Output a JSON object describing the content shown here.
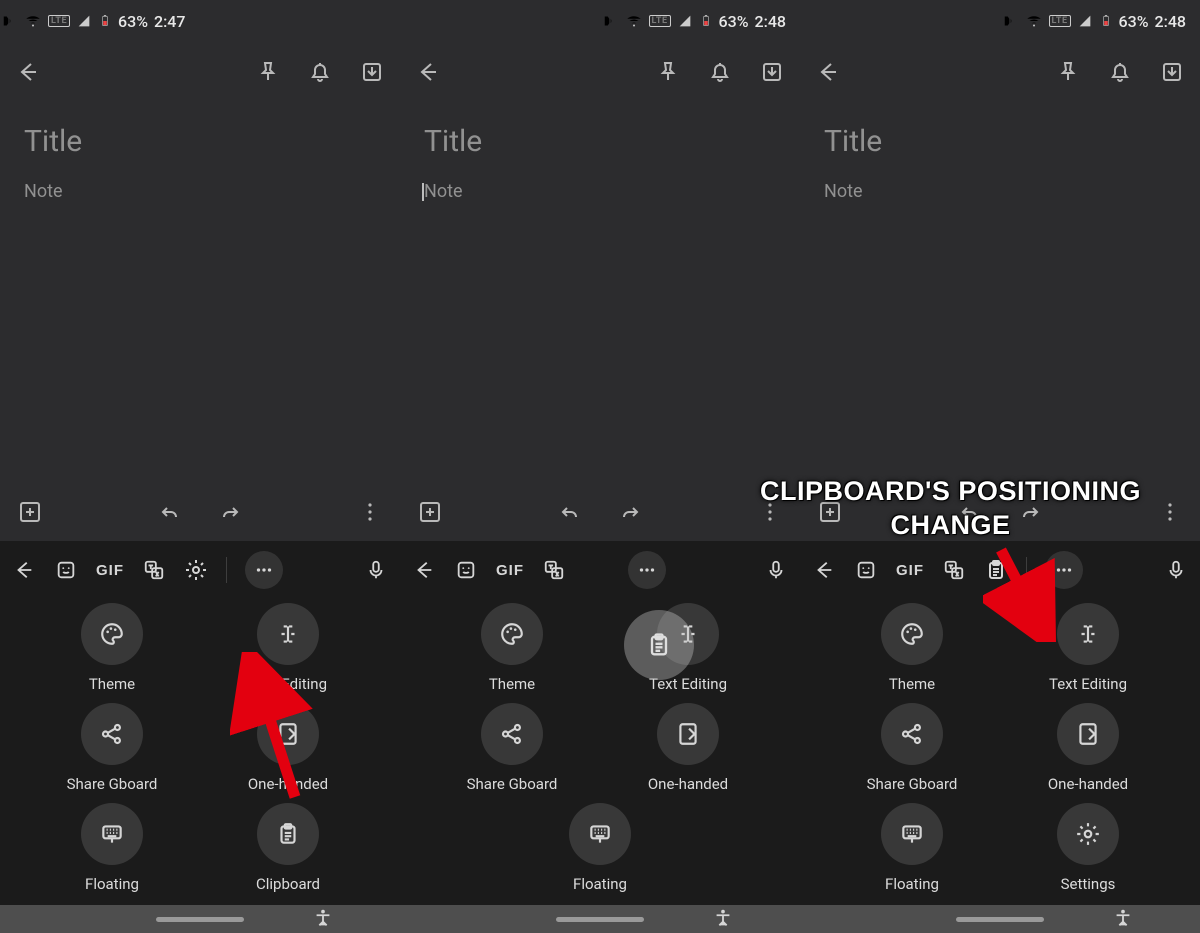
{
  "annotation": {
    "text": "CLIPBOARD'S POSITIONING\nCHANGE"
  },
  "panels": [
    {
      "status": {
        "battery_pct": "63%",
        "time": "2:47",
        "show_pic_icon": true
      },
      "content": {
        "title_placeholder": "Title",
        "note_placeholder": "Note",
        "caret": false
      },
      "kbar": {
        "slot5": "settings",
        "more_pill": true,
        "pre_sep": true
      },
      "tiles": [
        {
          "icon": "palette",
          "label": "Theme"
        },
        {
          "icon": "ibeam",
          "label": "Text Editing"
        },
        {
          "icon": "share",
          "label": "Share Gboard"
        },
        {
          "icon": "onehand",
          "label": "One-handed"
        },
        {
          "icon": "floatkb",
          "label": "Floating"
        },
        {
          "icon": "clipboard",
          "label": "Clipboard"
        }
      ]
    },
    {
      "status": {
        "battery_pct": "63%",
        "time": "2:48",
        "show_pic_icon": false
      },
      "content": {
        "title_placeholder": "Title",
        "note_placeholder": "Note",
        "caret": true
      },
      "kbar": {
        "slot5": "blank",
        "more_pill": true,
        "pre_sep": false
      },
      "tiles": [
        {
          "icon": "palette",
          "label": "Theme"
        },
        {
          "icon": "ibeam",
          "label": "Text Editing"
        },
        {
          "icon": "share",
          "label": "Share Gboard"
        },
        {
          "icon": "onehand",
          "label": "One-handed"
        },
        {
          "icon": "floatkb",
          "label": "Floating"
        }
      ],
      "dragging_clipboard": true
    },
    {
      "status": {
        "battery_pct": "63%",
        "time": "2:48",
        "show_pic_icon": false
      },
      "content": {
        "title_placeholder": "Title",
        "note_placeholder": "Note",
        "caret": false
      },
      "kbar": {
        "slot5": "clipboard",
        "more_pill": true,
        "pre_sep": true
      },
      "tiles": [
        {
          "icon": "palette",
          "label": "Theme"
        },
        {
          "icon": "ibeam",
          "label": "Text Editing"
        },
        {
          "icon": "share",
          "label": "Share Gboard"
        },
        {
          "icon": "onehand",
          "label": "One-handed"
        },
        {
          "icon": "floatkb",
          "label": "Floating"
        },
        {
          "icon": "settings",
          "label": "Settings"
        }
      ]
    }
  ]
}
